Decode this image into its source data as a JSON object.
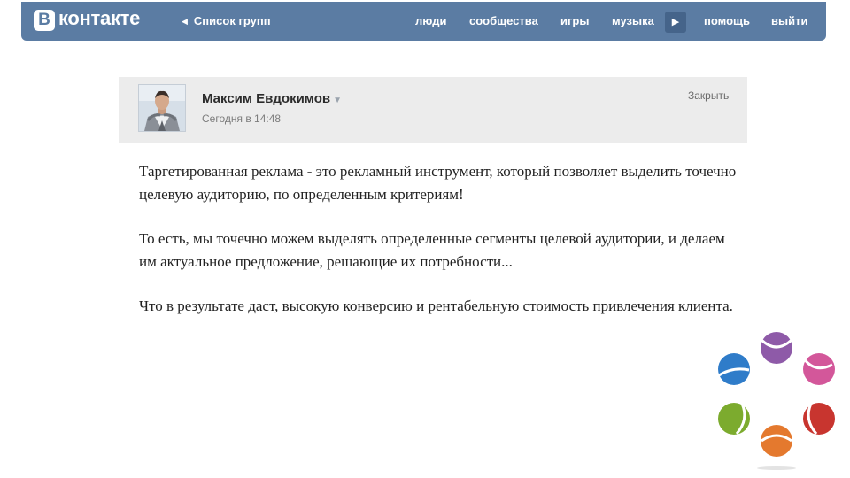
{
  "header": {
    "logo_badge": "В",
    "logo_text": "контакте",
    "back_label": "Список групп",
    "nav": [
      "люди",
      "сообщества",
      "игры",
      "музыка",
      "помощь",
      "выйти"
    ]
  },
  "post": {
    "author": "Максим Евдокимов",
    "time": "Сегодня в 14:48",
    "close_label": "Закрыть",
    "paragraphs": [
      "Таргетированная реклама - это рекламный инструмент, который позволяет выделить точечно целевую аудиторию, по определенным критериям!",
      "То есть, мы точечно можем выделять определенные сегменты целевой аудитории, и делаем им актуальное предложение, решающие их потребности...",
      "Что в результате даст, высокую конверсию и рентабельную стоимость привлечения клиента."
    ]
  },
  "colors": {
    "header_bg": "#5b7ca3",
    "post_header_bg": "#ececec",
    "emblem": [
      "#8e5aa8",
      "#d3579a",
      "#c8352f",
      "#e4792e",
      "#7cab2e",
      "#2f7cc9"
    ]
  },
  "icons": {
    "back": "triangle-left-icon",
    "nav_more": "play-arrow-icon",
    "author_menu": "caret-down-icon"
  }
}
